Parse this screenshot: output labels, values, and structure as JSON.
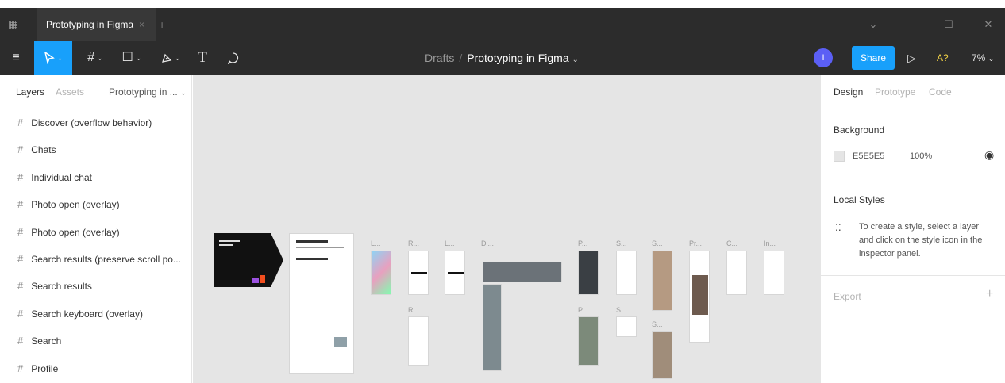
{
  "window": {
    "tab_title": "Prototyping in Figma",
    "tab_close": "×",
    "tab_add": "+",
    "controls": [
      "⌄",
      "—",
      "☐",
      "✕"
    ]
  },
  "toolbar": {
    "menu_icon": "hamburger-icon",
    "tools": [
      "move-tool-icon",
      "frame-tool-icon",
      "shape-tool-icon",
      "pen-tool-icon",
      "text-tool-icon",
      "comment-tool-icon"
    ],
    "text_tool": "T"
  },
  "breadcrumb": {
    "parent": "Drafts",
    "separator": "/",
    "current": "Prototyping in Figma"
  },
  "header_right": {
    "avatar_initial": "I",
    "share_label": "Share",
    "play_icon": "▷",
    "help_label": "A?",
    "zoom": "7%"
  },
  "left_panel": {
    "tabs": [
      "Layers",
      "Assets"
    ],
    "page_selector": "Prototyping in ...",
    "layers": [
      "Discover (overflow behavior)",
      "Chats",
      "Individual chat",
      "Photo open (overlay)",
      "Photo open (overlay)",
      "Search results (preserve scroll po...",
      "Search results",
      "Search keyboard (overlay)",
      "Search",
      "Profile"
    ]
  },
  "canvas": {
    "background": "#e5e5e5",
    "frame_labels": [
      "L...",
      "R...",
      "L...",
      "Di...",
      "P...",
      "S...",
      "S...",
      "Pr...",
      "C...",
      "In...",
      "R...",
      "P...",
      "S...",
      "S..."
    ]
  },
  "right_panel": {
    "tabs": [
      "Design",
      "Prototype",
      "Code"
    ],
    "background_title": "Background",
    "background_hex": "E5E5E5",
    "background_opacity": "100%",
    "local_styles_title": "Local Styles",
    "local_styles_hint": "To create a style, select a layer and click on the style icon in the inspector panel.",
    "export_title": "Export",
    "export_add": "+"
  },
  "colors": {
    "toolbar": "#2c2c2c",
    "accent": "#18a0fb",
    "avatar": "#5b5ff5",
    "canvas": "#e5e5e5"
  }
}
